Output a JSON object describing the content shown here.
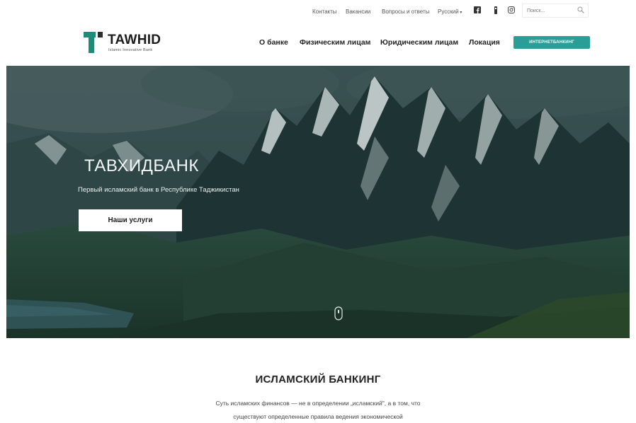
{
  "topbar": {
    "links": [
      "Контакты",
      "Вакансии",
      "Вопросы и ответы"
    ],
    "language": "Русский",
    "social_icons": [
      "facebook-icon",
      "instagram-icon",
      "youtube-icon"
    ],
    "search_placeholder": "Поиск..."
  },
  "header": {
    "logo_title": "TAWHID",
    "logo_subtitle": "Islamic Innovative Bank",
    "nav": [
      "О банке",
      "Физическим лицам",
      "Юридическим лицам",
      "Локация"
    ],
    "cta_label": "ИНТЕРНЕТБАНКИНГ"
  },
  "hero": {
    "title": "ТАВХИДБАНК",
    "subtitle": "Первый исламский банк в Республике Таджикистан",
    "button_label": "Наши услуги"
  },
  "section": {
    "title": "ИСЛАМСКИЙ БАНКИНГ",
    "lines": [
      "Суть исламских финансов — не в определении „исламский\", а в том, что",
      "существуют определенные правила ведения экономической"
    ]
  },
  "colors": {
    "accent": "#2a9d96",
    "logo_green": "#1f8c7a",
    "logo_dark": "#2b2b2b"
  }
}
